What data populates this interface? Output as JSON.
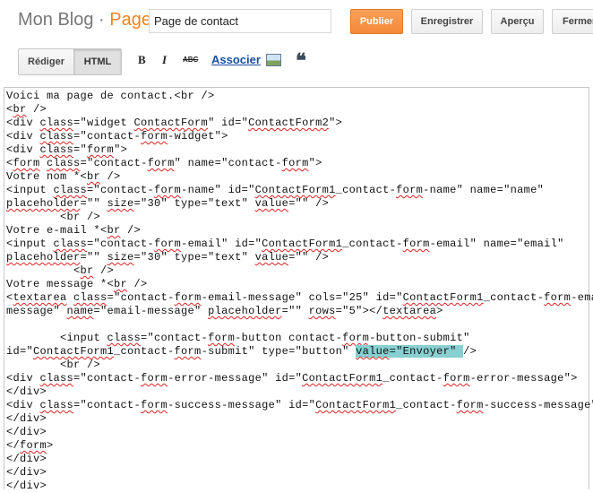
{
  "header": {
    "brand_prefix": "Mon Blog · ",
    "brand_suffix": "Page",
    "title_value": "Page de contact",
    "buttons": {
      "publish": "Publier",
      "save": "Enregistrer",
      "preview": "Aperçu",
      "close": "Fermer"
    }
  },
  "toolbar": {
    "compose_label": "Rédiger",
    "html_label": "HTML",
    "bold": "B",
    "italic": "I",
    "strike": "ABC",
    "link_label": "Associer",
    "image_icon": "image-icon",
    "quote": "❝"
  },
  "editor": {
    "lines": [
      [
        [
          "Voici ma page de contact.<br />"
        ]
      ],
      [
        [
          "<"
        ],
        [
          "br",
          "sp"
        ],
        [
          " />"
        ]
      ],
      [
        [
          "<div "
        ],
        [
          "class",
          "sp"
        ],
        [
          "=\"widget "
        ],
        [
          "ContactForm",
          "sp"
        ],
        [
          "\" id=\""
        ],
        [
          "ContactForm2",
          "sp"
        ],
        [
          "\">"
        ]
      ],
      [
        [
          "<div "
        ],
        [
          "class",
          "sp"
        ],
        [
          "=\"contact-"
        ],
        [
          "form",
          "sp"
        ],
        [
          "-widget\">"
        ]
      ],
      [
        [
          "<div "
        ],
        [
          "class",
          "sp"
        ],
        [
          "=\""
        ],
        [
          "form",
          "sp"
        ],
        [
          "\">"
        ]
      ],
      [
        [
          "<"
        ],
        [
          "form",
          "sp"
        ],
        [
          " "
        ],
        [
          "class",
          "sp"
        ],
        [
          "=\"contact-"
        ],
        [
          "form",
          "sp"
        ],
        [
          "\" name=\"contact-"
        ],
        [
          "form",
          "sp"
        ],
        [
          "\">"
        ]
      ],
      [
        [
          "Votre nom *<"
        ],
        [
          "br",
          "sp"
        ],
        [
          " />"
        ]
      ],
      [
        [
          "<input "
        ],
        [
          "class",
          "sp"
        ],
        [
          "=\"contact-"
        ],
        [
          "form",
          "sp"
        ],
        [
          "-name\" id=\""
        ],
        [
          "ContactForm1",
          "sp"
        ],
        [
          "_contact-"
        ],
        [
          "form",
          "sp"
        ],
        [
          "-name\" name=\"name\""
        ]
      ],
      [
        [
          "placeholder",
          "sp"
        ],
        [
          "=\"\" "
        ],
        [
          "size",
          "sp"
        ],
        [
          "=\"30\" type=\"text\" "
        ],
        [
          "value",
          "sp"
        ],
        [
          "=\"\" />"
        ]
      ],
      [
        [
          "        <br />"
        ]
      ],
      [
        [
          "Votre e-mail *<"
        ],
        [
          "br",
          "sp"
        ],
        [
          " />"
        ]
      ],
      [
        [
          "<input "
        ],
        [
          "class",
          "sp"
        ],
        [
          "=\"contact-"
        ],
        [
          "form",
          "sp"
        ],
        [
          "-email\" id=\""
        ],
        [
          "ContactForm1",
          "sp"
        ],
        [
          "_contact-"
        ],
        [
          "form",
          "sp"
        ],
        [
          "-email\" name=\"email\""
        ]
      ],
      [
        [
          "placeholder",
          "sp"
        ],
        [
          "=\"\" "
        ],
        [
          "size",
          "sp"
        ],
        [
          "=\"30\" type=\"text\" "
        ],
        [
          "value",
          "sp"
        ],
        [
          "=\"\" />"
        ]
      ],
      [
        [
          "          <"
        ],
        [
          "br",
          "sp"
        ],
        [
          " />"
        ]
      ],
      [
        [
          "Votre message *<"
        ],
        [
          "br",
          "sp"
        ],
        [
          " />"
        ]
      ],
      [
        [
          "<"
        ],
        [
          "textarea",
          "sp"
        ],
        [
          " "
        ],
        [
          "class",
          "sp"
        ],
        [
          "=\"contact-"
        ],
        [
          "form",
          "sp"
        ],
        [
          "-email-message\" cols=\"25\" id=\""
        ],
        [
          "ContactForm1",
          "sp"
        ],
        [
          "_contact-"
        ],
        [
          "form",
          "sp"
        ],
        [
          "-email-"
        ]
      ],
      [
        [
          "message\" "
        ],
        [
          "name",
          "sp"
        ],
        [
          "=\"email-message\" "
        ],
        [
          "placeholder",
          "sp"
        ],
        [
          "=\"\" "
        ],
        [
          "rows",
          "sp"
        ],
        [
          "=\"5\"></"
        ],
        [
          "textarea",
          "sp"
        ],
        [
          ">"
        ]
      ],
      [
        [
          ""
        ]
      ],
      [
        [
          "        <input "
        ],
        [
          "class",
          "sp"
        ],
        [
          "=\"contact-"
        ],
        [
          "form",
          "sp"
        ],
        [
          "-button contact-"
        ],
        [
          "form",
          "sp"
        ],
        [
          "-button-submit\""
        ]
      ],
      [
        [
          "id=\""
        ],
        [
          "ContactForm1",
          "sp"
        ],
        [
          "_contact-"
        ],
        [
          "form",
          "sp"
        ],
        [
          "-submit\" type=\"button\" "
        ],
        [
          "value",
          "sp hl"
        ],
        [
          "=\"Envoyer\" ",
          "hl"
        ],
        [
          "/>"
        ]
      ],
      [
        [
          "        <br />"
        ]
      ],
      [
        [
          "<div "
        ],
        [
          "class",
          "sp"
        ],
        [
          "=\"contact-"
        ],
        [
          "form",
          "sp"
        ],
        [
          "-error-message\" id=\""
        ],
        [
          "ContactForm1",
          "sp"
        ],
        [
          "_contact-"
        ],
        [
          "form",
          "sp"
        ],
        [
          "-error-message\">"
        ]
      ],
      [
        [
          "</div>"
        ]
      ],
      [
        [
          "<div "
        ],
        [
          "class",
          "sp"
        ],
        [
          "=\"contact-"
        ],
        [
          "form",
          "sp"
        ],
        [
          "-success-message\" id=\""
        ],
        [
          "ContactForm1",
          "sp"
        ],
        [
          "_contact-"
        ],
        [
          "form",
          "sp"
        ],
        [
          "-success-message\">"
        ]
      ],
      [
        [
          "</div>"
        ]
      ],
      [
        [
          "</div>"
        ]
      ],
      [
        [
          "</"
        ],
        [
          "form",
          "sp"
        ],
        [
          ">"
        ]
      ],
      [
        [
          "</div>"
        ]
      ],
      [
        [
          "</div>"
        ]
      ],
      [
        [
          "</div>"
        ]
      ]
    ]
  },
  "colors": {
    "accent": "#f58220",
    "link": "#1a4ea1",
    "highlight": "#87cfd0",
    "spellcheck": "#dd2222"
  }
}
